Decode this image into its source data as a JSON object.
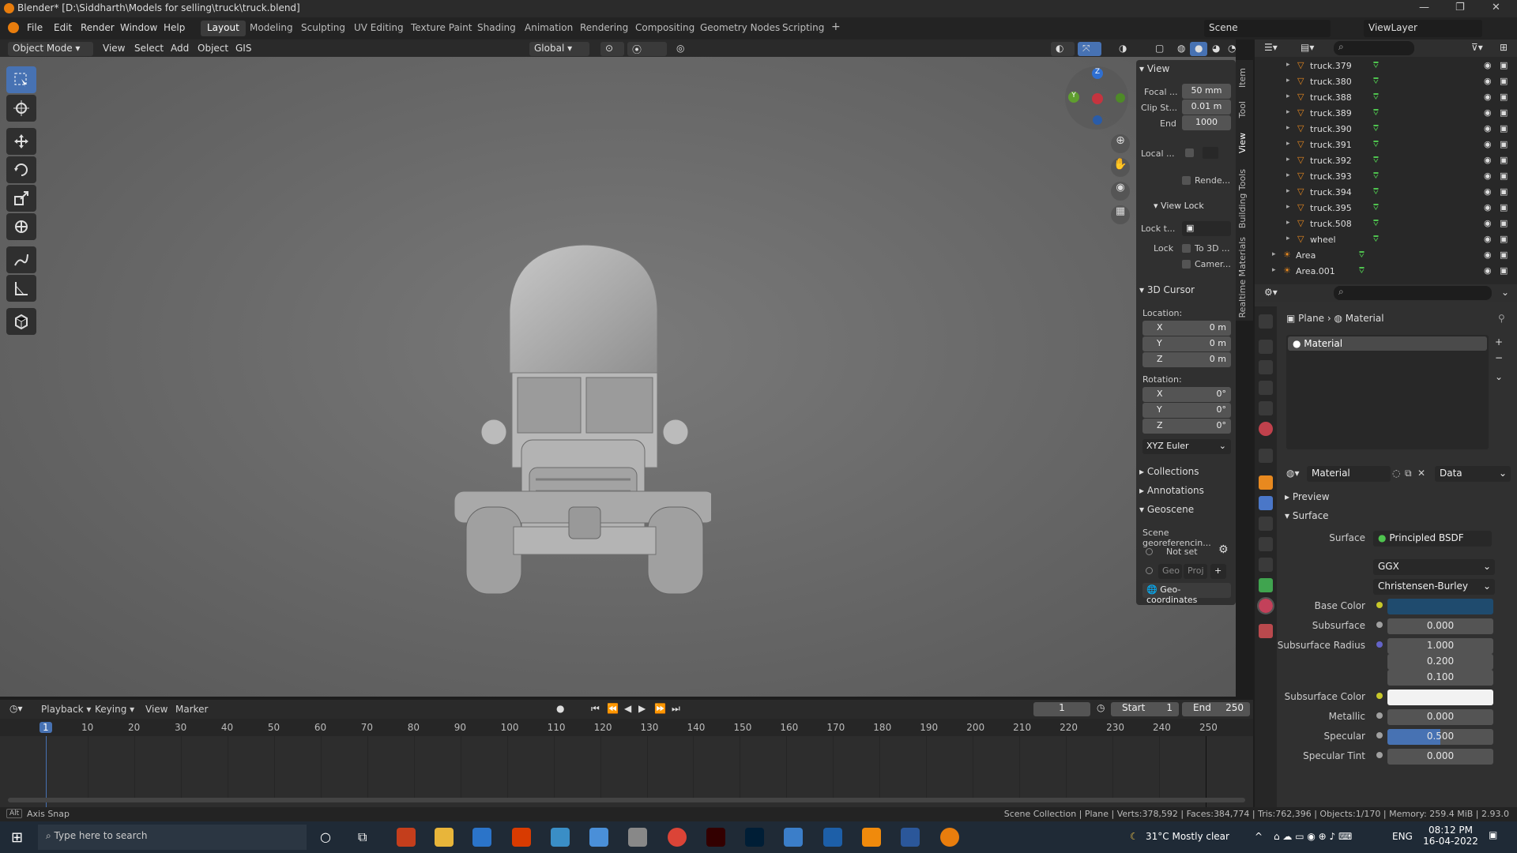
{
  "window": {
    "title": "Blender* [D:\\Siddharth\\Models for selling\\truck\\truck.blend]"
  },
  "menu": {
    "items": [
      "File",
      "Edit",
      "Render",
      "Window",
      "Help"
    ]
  },
  "workspaces": [
    "Layout",
    "Modeling",
    "Sculpting",
    "UV Editing",
    "Texture Paint",
    "Shading",
    "Animation",
    "Rendering",
    "Compositing",
    "Geometry Nodes",
    "Scripting"
  ],
  "header": {
    "scene": "Scene",
    "view_layer": "ViewLayer"
  },
  "viewport_header": {
    "mode": "Object Mode",
    "menus": [
      "View",
      "Select",
      "Add",
      "Object",
      "GIS"
    ],
    "orientation": "Global"
  },
  "npanel": {
    "view_title": "View",
    "focal_label": "Focal ...",
    "focal_value": "50 mm",
    "clip_start_label": "Clip St...",
    "clip_start_value": "0.01 m",
    "end_label": "End",
    "end_value": "1000",
    "local_label": "Local ...",
    "render_label": "Rende...",
    "view_lock_title": "View Lock",
    "lock_to_label": "Lock t...",
    "lock_label": "Lock",
    "to3d_label": "To 3D ...",
    "camera_label": "Camer...",
    "cursor_title": "3D Cursor",
    "location_label": "Location:",
    "loc_x": "0 m",
    "loc_y": "0 m",
    "loc_z": "0 m",
    "rotation_label": "Rotation:",
    "rot_x": "0°",
    "rot_y": "0°",
    "rot_z": "0°",
    "rot_mode": "XYZ Euler",
    "collections": "Collections",
    "annotations": "Annotations",
    "geoscene": "Geoscene",
    "scene_geo": "Scene georeferencin...",
    "not_set": "Not set",
    "geo": "Geo",
    "proj": "Proj",
    "geo_coords": "Geo-coordinates"
  },
  "vtabs": [
    "Item",
    "Tool",
    "View",
    "Building Tools",
    "Realtime Materials"
  ],
  "outliner": {
    "items": [
      "truck.379",
      "truck.380",
      "truck.388",
      "truck.389",
      "truck.390",
      "truck.391",
      "truck.392",
      "truck.393",
      "truck.394",
      "truck.395",
      "truck.508",
      "wheel"
    ],
    "lights": [
      "Area",
      "Area.001"
    ]
  },
  "properties": {
    "breadcrumb_obj": "Plane",
    "breadcrumb_mat": "Material",
    "slot": "Material",
    "material_name": "Material",
    "link": "Data",
    "preview": "Preview",
    "surface_section": "Surface",
    "surface_label": "Surface",
    "surface_value": "Principled BSDF",
    "distribution": "GGX",
    "subsurface_method": "Christensen-Burley",
    "base_color_label": "Base Color",
    "base_color": "#1f4b6e",
    "subsurface_label": "Subsurface",
    "subsurface_value": "0.000",
    "ss_radius_label": "Subsurface Radius",
    "ss_radius": [
      "1.000",
      "0.200",
      "0.100"
    ],
    "ss_color_label": "Subsurface Color",
    "metallic_label": "Metallic",
    "metallic_value": "0.000",
    "specular_label": "Specular",
    "specular_value": "0.500",
    "specular_fill": 0.5,
    "spec_tint_label": "Specular Tint",
    "spec_tint_value": "0.000"
  },
  "timeline": {
    "menus": [
      "Playback",
      "Keying",
      "View",
      "Marker"
    ],
    "current_frame": "1",
    "start_label": "Start",
    "start": "1",
    "end_label": "End",
    "end": "250",
    "ticks": [
      "1",
      "10",
      "20",
      "30",
      "40",
      "50",
      "60",
      "70",
      "80",
      "90",
      "100",
      "110",
      "120",
      "130",
      "140",
      "150",
      "160",
      "170",
      "180",
      "190",
      "200",
      "210",
      "220",
      "230",
      "240",
      "250"
    ]
  },
  "statusbar": {
    "left": "Axis Snap",
    "right": "Scene Collection | Plane | Verts:378,592 | Faces:384,774 | Tris:762,396 | Objects:1/170 | Memory: 259.4 MiB | 2.93.0"
  },
  "taskbar": {
    "search_placeholder": "Type here to search",
    "weather": "31°C  Mostly clear",
    "lang": "ENG",
    "time": "08:12 PM",
    "date": "16-04-2022"
  }
}
